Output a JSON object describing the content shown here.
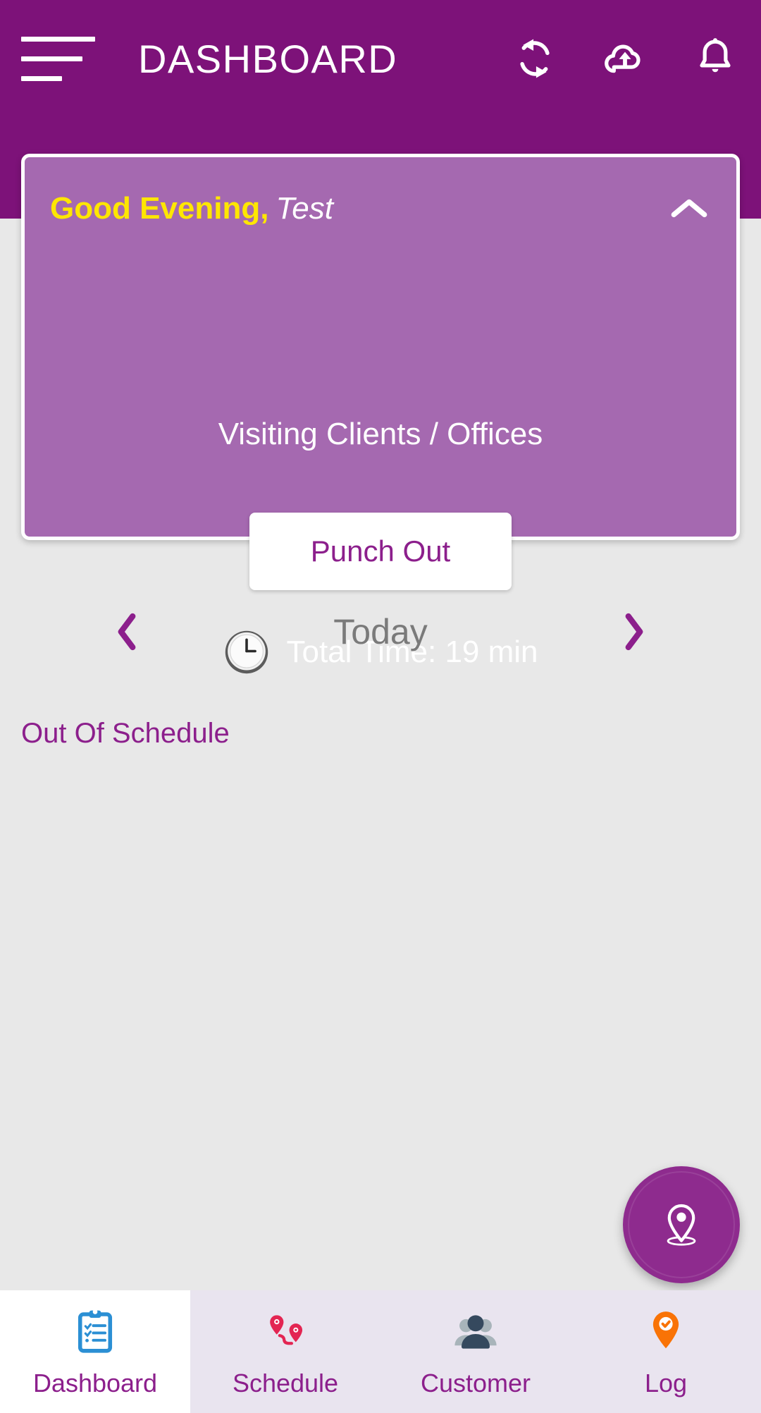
{
  "header": {
    "title": "DASHBOARD",
    "menu_icon": "hamburger-menu-icon",
    "sync_icon": "sync-refresh-icon",
    "upload_icon": "cloud-upload-icon",
    "notification_icon": "notification-bell-icon",
    "background_color": "#7d1279"
  },
  "greeting_card": {
    "salutation": "Good Evening,",
    "username": "Test",
    "collapse_icon": "chevron-up-icon",
    "status": "Visiting Clients / Offices",
    "punch_label": "Punch Out",
    "clock_icon": "clock-icon",
    "total_time": "Total Time: 19 min",
    "background_color": "#a569b0",
    "salutation_color": "#ffe600"
  },
  "date_nav": {
    "prev_icon": "chevron-left-icon",
    "label": "Today",
    "next_icon": "chevron-right-icon",
    "accent_color": "#8c1f8c"
  },
  "schedule": {
    "section_title": "Out Of Schedule",
    "items": []
  },
  "fab": {
    "icon": "location-pin-icon",
    "background_color": "#8e2b8e"
  },
  "bottom_nav": {
    "items": [
      {
        "label": "Dashboard",
        "icon": "clipboard-checklist-icon",
        "active": true,
        "icon_color": "#2b8fd4"
      },
      {
        "label": "Schedule",
        "icon": "route-pins-icon",
        "active": false,
        "icon_color": "#e32552"
      },
      {
        "label": "Customer",
        "icon": "people-icon",
        "active": false,
        "icon_color": "#35495e"
      },
      {
        "label": "Log",
        "icon": "pin-check-icon",
        "active": false,
        "icon_color": "#f97306"
      }
    ],
    "label_color": "#8c1f8c"
  }
}
